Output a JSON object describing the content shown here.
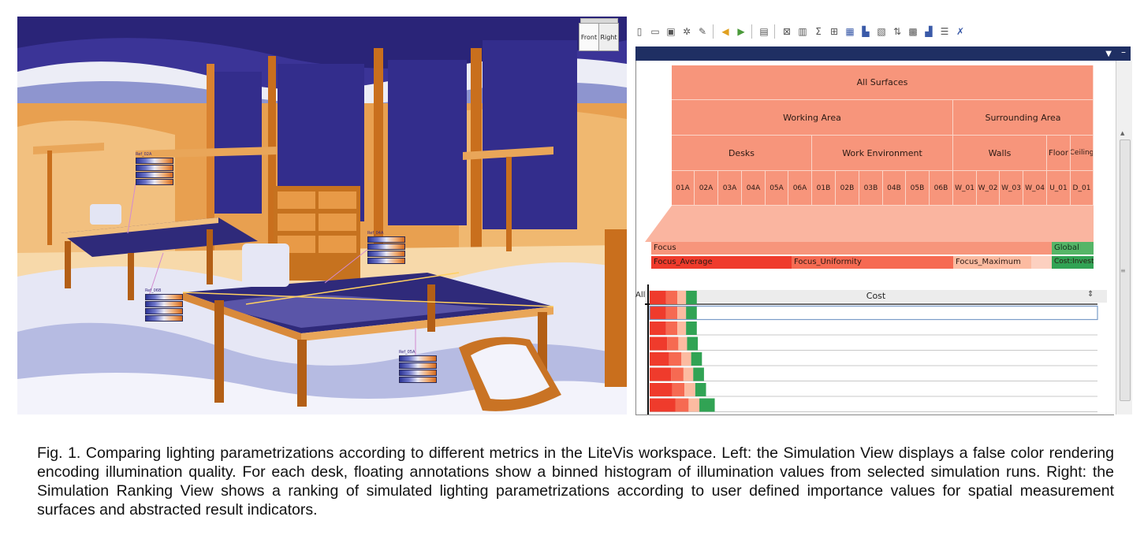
{
  "simulation_view": {
    "orientation_cube": {
      "front": "Front",
      "right": "Right"
    },
    "histograms": [
      {
        "label": "Ref_02A",
        "bars": 4
      },
      {
        "label": "Ref_04A",
        "bars": 4
      },
      {
        "label": "Ref_06B",
        "bars": 4
      },
      {
        "label": "Ref_05A",
        "bars": 4
      }
    ]
  },
  "ranking_view": {
    "toolbar_icons": [
      "new-file-icon",
      "open-folder-icon",
      "save-icon",
      "settings-icon",
      "edit-icon",
      "undo-icon",
      "redo-icon",
      "clipboard-icon",
      "filter-icon",
      "columns-icon",
      "sum-icon",
      "compare-icon",
      "grid-icon",
      "bars-icon",
      "table-icon",
      "sort-icon",
      "chart-icon",
      "histogram-icon",
      "list-icon",
      "brush-icon"
    ],
    "hierarchy": {
      "root": "All Surfaces",
      "level1": [
        "Working Area",
        "Surrounding Area"
      ],
      "level2": [
        "Desks",
        "Work Environment",
        "Walls",
        "Floor",
        "Ceiling"
      ],
      "leaves": [
        "01A",
        "02A",
        "03A",
        "04A",
        "05A",
        "06A",
        "01B",
        "02B",
        "03B",
        "04B",
        "05B",
        "06B",
        "W_01",
        "W_02",
        "W_03",
        "W_04",
        "U_01",
        "D_01"
      ]
    },
    "indicators": {
      "group_focus": "Focus",
      "group_global": "Global",
      "focus_average": "Focus_Average",
      "focus_uniformity": "Focus_Uniformity",
      "focus_maximum": "Focus_Maximum",
      "cost_invest": "Cost:Invest",
      "all_label": "All",
      "cost_header": "Cost"
    },
    "colors": {
      "surface": "#f7957b",
      "focus_average": "#ef3b2c",
      "focus_uniformity": "#f66a52",
      "focus_maximum": "#fcbba1",
      "global": "#31a354"
    },
    "ranking_rows": [
      {
        "average": 0.32,
        "uniformity": 0.22,
        "maximum": 0.17,
        "cost": 0.21
      },
      {
        "average": 0.32,
        "uniformity": 0.22,
        "maximum": 0.17,
        "cost": 0.21
      },
      {
        "average": 0.32,
        "uniformity": 0.22,
        "maximum": 0.17,
        "cost": 0.21
      },
      {
        "average": 0.34,
        "uniformity": 0.22,
        "maximum": 0.17,
        "cost": 0.21
      },
      {
        "average": 0.38,
        "uniformity": 0.24,
        "maximum": 0.19,
        "cost": 0.21
      },
      {
        "average": 0.42,
        "uniformity": 0.24,
        "maximum": 0.19,
        "cost": 0.21
      },
      {
        "average": 0.44,
        "uniformity": 0.24,
        "maximum": 0.21,
        "cost": 0.21
      },
      {
        "average": 0.5,
        "uniformity": 0.26,
        "maximum": 0.21,
        "cost": 0.3
      }
    ]
  },
  "caption": "Fig. 1. Comparing lighting parametrizations according to different metrics in the LiteVis workspace. Left: the Simulation View displays a false color rendering encoding illumination quality. For each desk, floating annotations show a binned histogram of illumination values from selected simulation runs. Right: the Simulation Ranking View shows a ranking of simulated lighting parametrizations according to user defined importance values for spatial measurement surfaces and abstracted result indicators."
}
